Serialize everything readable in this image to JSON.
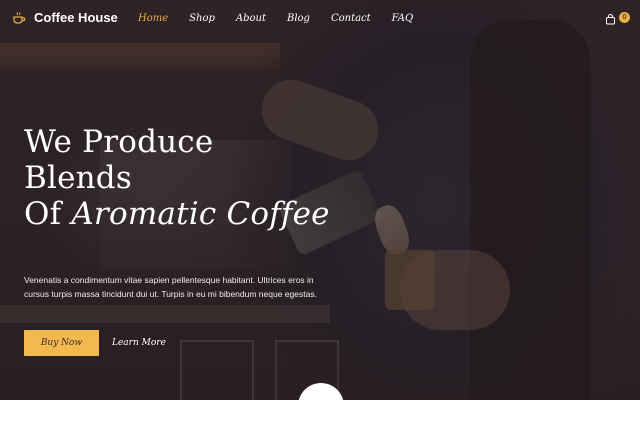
{
  "brand": {
    "name": "Coffee House",
    "icon": "coffee-cup-icon"
  },
  "nav": {
    "items": [
      {
        "label": "Home",
        "active": true
      },
      {
        "label": "Shop",
        "active": false
      },
      {
        "label": "About",
        "active": false
      },
      {
        "label": "Blog",
        "active": false
      },
      {
        "label": "Contact",
        "active": false
      },
      {
        "label": "FAQ",
        "active": false
      }
    ],
    "cart": {
      "icon": "shopping-bag-icon",
      "count": "0"
    }
  },
  "hero": {
    "headline_line1": "We Produce",
    "headline_line2": "Blends",
    "headline_line3_prefix": "Of ",
    "headline_line3_emphasis": "Aromatic Coffee",
    "description": "Venenatis a condimentum vitae sapien pellentesque habitant. Ultrices eros in cursus turpis massa tincidunt dui ut. Turpis in eu mi bibendum neque egestas.",
    "primary_button": "Buy Now",
    "secondary_button": "Learn More"
  },
  "colors": {
    "accent": "#e8b04a",
    "button": "#f3b950",
    "text": "#ffffff"
  }
}
